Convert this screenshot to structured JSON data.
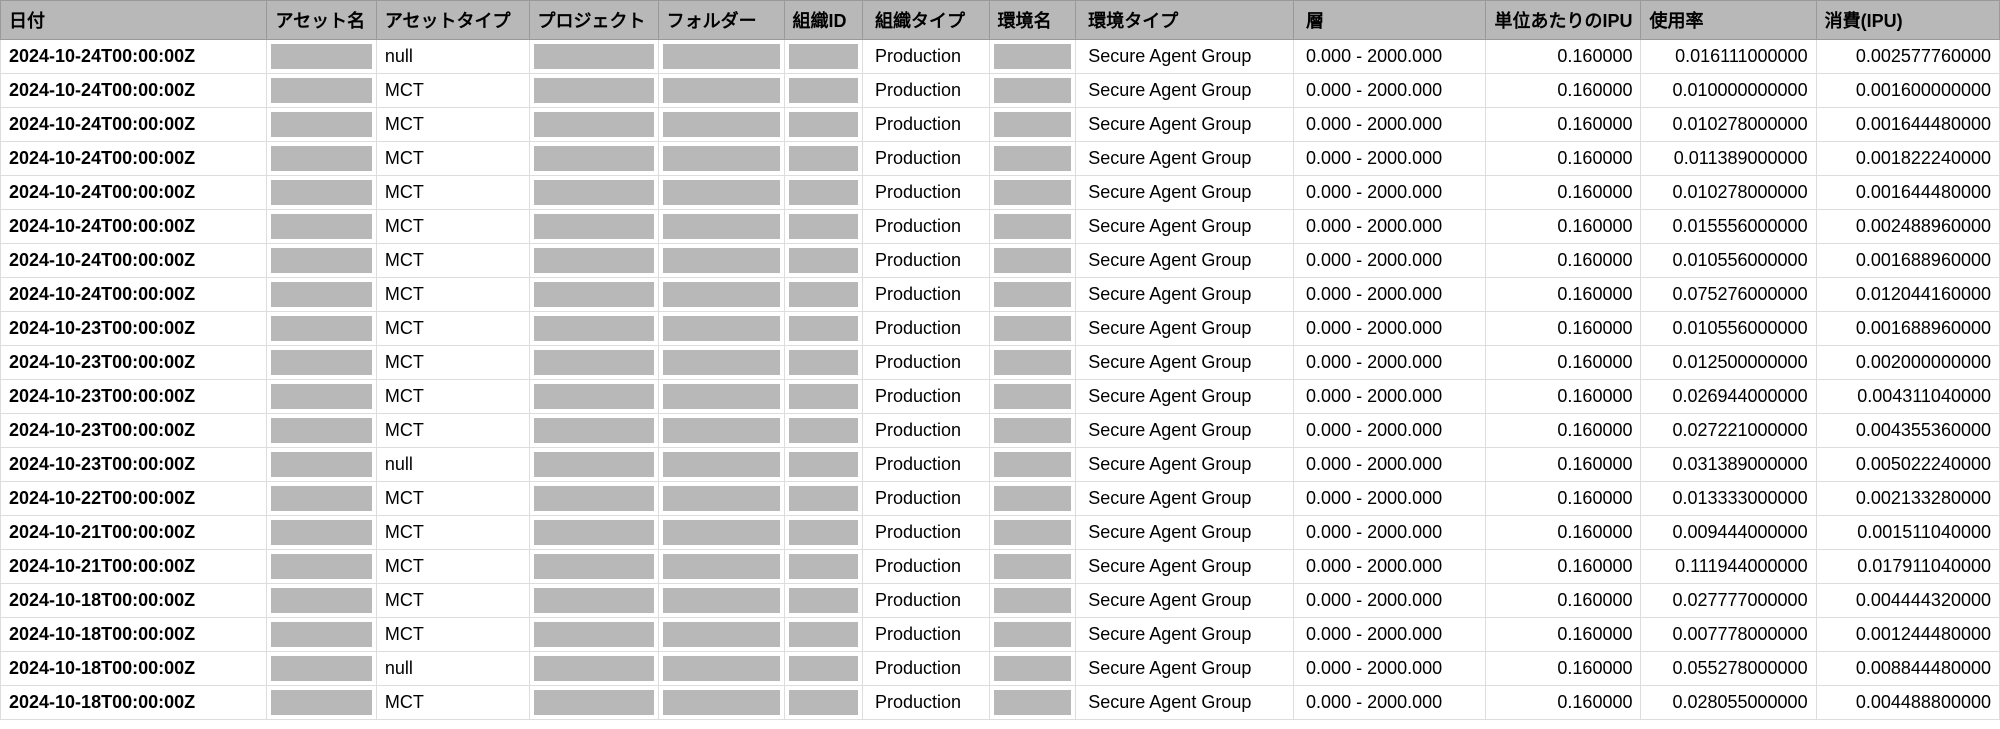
{
  "headers": {
    "date": "日付",
    "asset_name": "アセット名",
    "asset_type": "アセットタイプ",
    "project": "プロジェクト",
    "folder": "フォルダー",
    "org_id": "組織ID",
    "org_type": "組織タイプ",
    "env_name": "環境名",
    "env_type": "環境タイプ",
    "tier": "層",
    "ipu_per_unit": "単位あたりのIPU",
    "usage": "使用率",
    "consumption": "消費(IPU)"
  },
  "rows": [
    {
      "date": "2024-10-24T00:00:00Z",
      "asset_type": "null",
      "org_type": "Production",
      "env_type": "Secure Agent Group",
      "tier": "0.000 - 2000.000",
      "ipu_per_unit": "0.160000",
      "usage": "0.016111000000",
      "consumption": "0.002577760000"
    },
    {
      "date": "2024-10-24T00:00:00Z",
      "asset_type": "MCT",
      "org_type": "Production",
      "env_type": "Secure Agent Group",
      "tier": "0.000 - 2000.000",
      "ipu_per_unit": "0.160000",
      "usage": "0.010000000000",
      "consumption": "0.001600000000"
    },
    {
      "date": "2024-10-24T00:00:00Z",
      "asset_type": "MCT",
      "org_type": "Production",
      "env_type": "Secure Agent Group",
      "tier": "0.000 - 2000.000",
      "ipu_per_unit": "0.160000",
      "usage": "0.010278000000",
      "consumption": "0.001644480000"
    },
    {
      "date": "2024-10-24T00:00:00Z",
      "asset_type": "MCT",
      "org_type": "Production",
      "env_type": "Secure Agent Group",
      "tier": "0.000 - 2000.000",
      "ipu_per_unit": "0.160000",
      "usage": "0.011389000000",
      "consumption": "0.001822240000"
    },
    {
      "date": "2024-10-24T00:00:00Z",
      "asset_type": "MCT",
      "org_type": "Production",
      "env_type": "Secure Agent Group",
      "tier": "0.000 - 2000.000",
      "ipu_per_unit": "0.160000",
      "usage": "0.010278000000",
      "consumption": "0.001644480000"
    },
    {
      "date": "2024-10-24T00:00:00Z",
      "asset_type": "MCT",
      "org_type": "Production",
      "env_type": "Secure Agent Group",
      "tier": "0.000 - 2000.000",
      "ipu_per_unit": "0.160000",
      "usage": "0.015556000000",
      "consumption": "0.002488960000"
    },
    {
      "date": "2024-10-24T00:00:00Z",
      "asset_type": "MCT",
      "org_type": "Production",
      "env_type": "Secure Agent Group",
      "tier": "0.000 - 2000.000",
      "ipu_per_unit": "0.160000",
      "usage": "0.010556000000",
      "consumption": "0.001688960000"
    },
    {
      "date": "2024-10-24T00:00:00Z",
      "asset_type": "MCT",
      "org_type": "Production",
      "env_type": "Secure Agent Group",
      "tier": "0.000 - 2000.000",
      "ipu_per_unit": "0.160000",
      "usage": "0.075276000000",
      "consumption": "0.012044160000"
    },
    {
      "date": "2024-10-23T00:00:00Z",
      "asset_type": "MCT",
      "org_type": "Production",
      "env_type": "Secure Agent Group",
      "tier": "0.000 - 2000.000",
      "ipu_per_unit": "0.160000",
      "usage": "0.010556000000",
      "consumption": "0.001688960000"
    },
    {
      "date": "2024-10-23T00:00:00Z",
      "asset_type": "MCT",
      "org_type": "Production",
      "env_type": "Secure Agent Group",
      "tier": "0.000 - 2000.000",
      "ipu_per_unit": "0.160000",
      "usage": "0.012500000000",
      "consumption": "0.002000000000"
    },
    {
      "date": "2024-10-23T00:00:00Z",
      "asset_type": "MCT",
      "org_type": "Production",
      "env_type": "Secure Agent Group",
      "tier": "0.000 - 2000.000",
      "ipu_per_unit": "0.160000",
      "usage": "0.026944000000",
      "consumption": "0.004311040000"
    },
    {
      "date": "2024-10-23T00:00:00Z",
      "asset_type": "MCT",
      "org_type": "Production",
      "env_type": "Secure Agent Group",
      "tier": "0.000 - 2000.000",
      "ipu_per_unit": "0.160000",
      "usage": "0.027221000000",
      "consumption": "0.004355360000"
    },
    {
      "date": "2024-10-23T00:00:00Z",
      "asset_type": "null",
      "org_type": "Production",
      "env_type": "Secure Agent Group",
      "tier": "0.000 - 2000.000",
      "ipu_per_unit": "0.160000",
      "usage": "0.031389000000",
      "consumption": "0.005022240000"
    },
    {
      "date": "2024-10-22T00:00:00Z",
      "asset_type": "MCT",
      "org_type": "Production",
      "env_type": "Secure Agent Group",
      "tier": "0.000 - 2000.000",
      "ipu_per_unit": "0.160000",
      "usage": "0.013333000000",
      "consumption": "0.002133280000"
    },
    {
      "date": "2024-10-21T00:00:00Z",
      "asset_type": "MCT",
      "org_type": "Production",
      "env_type": "Secure Agent Group",
      "tier": "0.000 - 2000.000",
      "ipu_per_unit": "0.160000",
      "usage": "0.009444000000",
      "consumption": "0.001511040000"
    },
    {
      "date": "2024-10-21T00:00:00Z",
      "asset_type": "MCT",
      "org_type": "Production",
      "env_type": "Secure Agent Group",
      "tier": "0.000 - 2000.000",
      "ipu_per_unit": "0.160000",
      "usage": "0.111944000000",
      "consumption": "0.017911040000"
    },
    {
      "date": "2024-10-18T00:00:00Z",
      "asset_type": "MCT",
      "org_type": "Production",
      "env_type": "Secure Agent Group",
      "tier": "0.000 - 2000.000",
      "ipu_per_unit": "0.160000",
      "usage": "0.027777000000",
      "consumption": "0.004444320000"
    },
    {
      "date": "2024-10-18T00:00:00Z",
      "asset_type": "MCT",
      "org_type": "Production",
      "env_type": "Secure Agent Group",
      "tier": "0.000 - 2000.000",
      "ipu_per_unit": "0.160000",
      "usage": "0.007778000000",
      "consumption": "0.001244480000"
    },
    {
      "date": "2024-10-18T00:00:00Z",
      "asset_type": "null",
      "org_type": "Production",
      "env_type": "Secure Agent Group",
      "tier": "0.000 - 2000.000",
      "ipu_per_unit": "0.160000",
      "usage": "0.055278000000",
      "consumption": "0.008844480000"
    },
    {
      "date": "2024-10-18T00:00:00Z",
      "asset_type": "MCT",
      "org_type": "Production",
      "env_type": "Secure Agent Group",
      "tier": "0.000 - 2000.000",
      "ipu_per_unit": "0.160000",
      "usage": "0.028055000000",
      "consumption": "0.004488800000"
    }
  ]
}
